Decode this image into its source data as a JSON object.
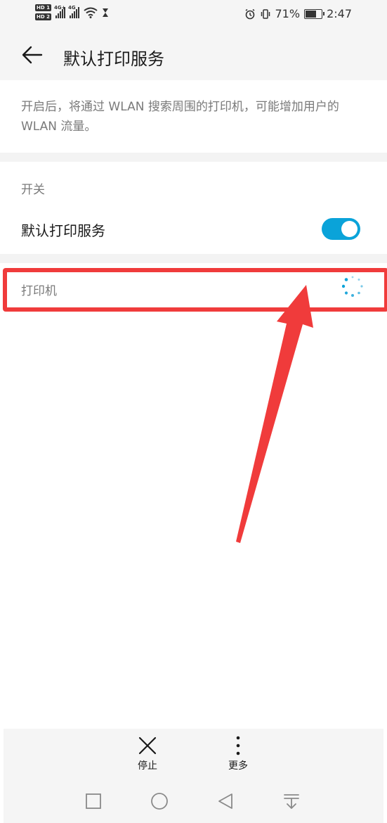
{
  "status_bar": {
    "hd1_label": "HD 1",
    "hd2_label": "HD 2",
    "sim1_network": "4G+",
    "sim2_network": "4G",
    "battery_percent": "71%",
    "battery_level": 0.71,
    "time": "2:47"
  },
  "header": {
    "title": "默认打印服务"
  },
  "description": "开启后，将通过 WLAN 搜索周围的打印机，可能增加用户的 WLAN 流量。",
  "switch_section": {
    "label": "开关",
    "row_title": "默认打印服务",
    "enabled": true
  },
  "printers_section": {
    "label": "打印机"
  },
  "toolbar": {
    "stop_label": "停止",
    "more_label": "更多"
  },
  "colors": {
    "accent": "#0aa3d9",
    "annotation": "#f03b3b"
  },
  "icons": {
    "back": "arrow-left-icon",
    "stop": "close-x-icon",
    "more": "vertical-dots-icon",
    "loading": "spinner-icon"
  }
}
